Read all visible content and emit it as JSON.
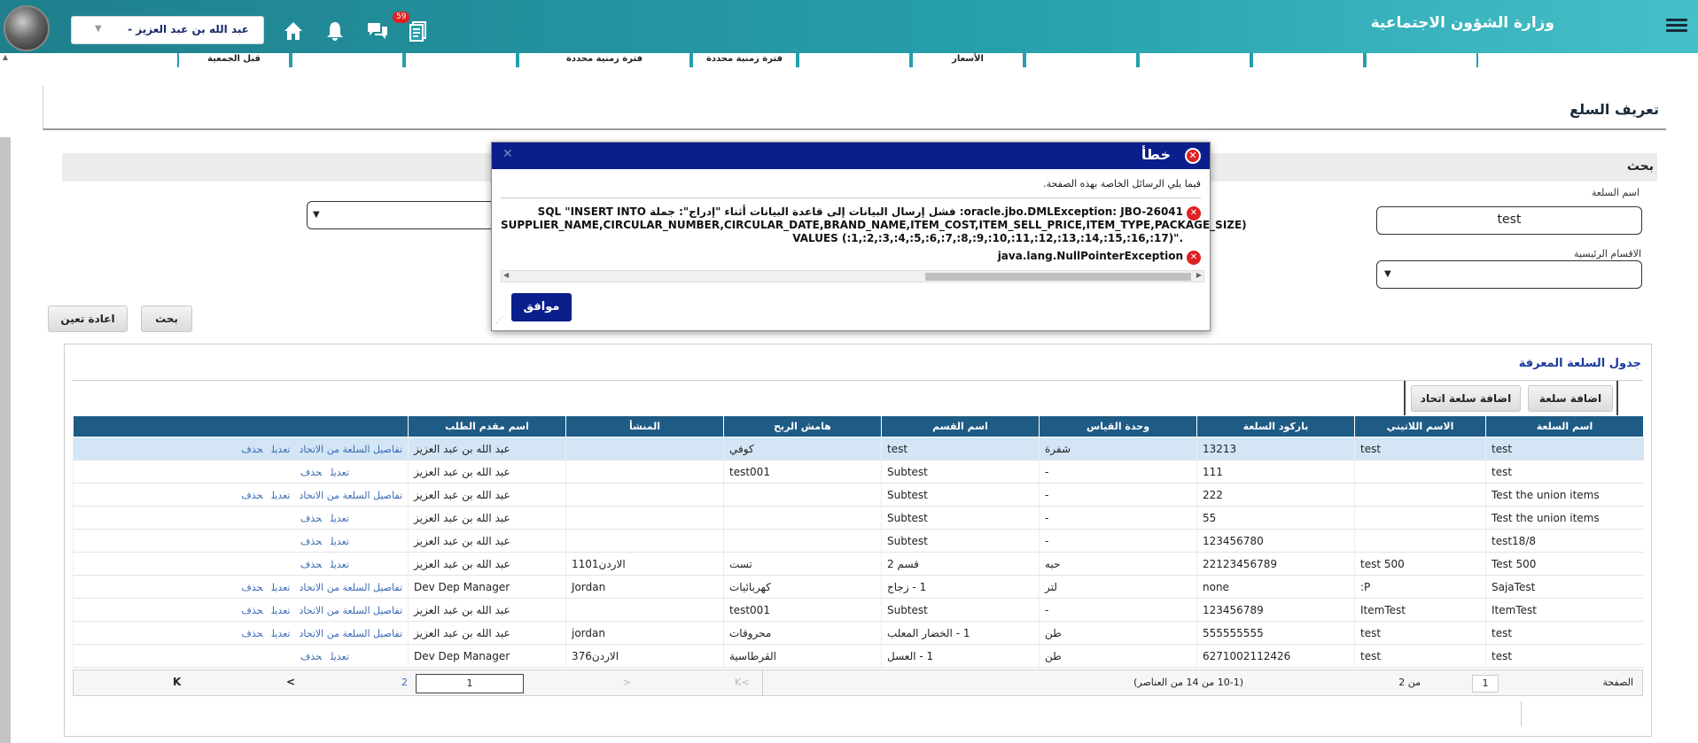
{
  "header": {
    "ministry_title": "وزارة الشؤون الاجتماعية",
    "user_name": "عبد الله بن عبد العزيز",
    "user_prefix": "-",
    "notification_count": "59"
  },
  "stubs": [
    "قبل الجمعية",
    "فترة زمنية محددة",
    "فترة زمنية محددة",
    "الأسعار"
  ],
  "page": {
    "title": "تعريف السلع"
  },
  "search": {
    "title": "بحث",
    "item_name_label": "اسم السلعة",
    "item_name_value": "test",
    "main_sections_label": "الاقسام الرئيسية",
    "search_button": "بحث",
    "reset_button": "اعادة تعين"
  },
  "table": {
    "title": "جدول السلعة المعرفة",
    "add_item_button": "اضافة سلعة",
    "add_union_item_button": "اضافة سلعة اتحاد",
    "columns": [
      "اسم السلعة",
      "الاسم اللاتيني",
      "باركود السلعة",
      "وحدة القياس",
      "اسم القسم",
      "هامش الربح",
      "المنشأ",
      "اسم مقدم الطلب",
      ""
    ],
    "link_details": "تفاصيل السلعة من الاتحاد",
    "link_edit": "تعديل",
    "link_delete": "حذف",
    "rows": [
      {
        "name": "test",
        "latin": "test",
        "barcode": "13213",
        "unit": "شفرة",
        "section": "test",
        "margin": "كوفي",
        "origin": "",
        "requester": "عبد الله بن عبد العزيز",
        "details": true
      },
      {
        "name": "test",
        "latin": "",
        "barcode": "111",
        "unit": "-",
        "section": "Subtest",
        "margin": "test001",
        "origin": "",
        "requester": "عبد الله بن عبد العزيز",
        "details": false
      },
      {
        "name": "Test the union items",
        "latin": "",
        "barcode": "222",
        "unit": "-",
        "section": "Subtest",
        "margin": "",
        "origin": "",
        "requester": "عبد الله بن عبد العزيز",
        "details": true
      },
      {
        "name": "Test the union items",
        "latin": "",
        "barcode": "55",
        "unit": "-",
        "section": "Subtest",
        "margin": "",
        "origin": "",
        "requester": "عبد الله بن عبد العزيز",
        "details": false
      },
      {
        "name": "test18/8",
        "latin": "",
        "barcode": "123456780",
        "unit": "-",
        "section": "Subtest",
        "margin": "",
        "origin": "",
        "requester": "عبد الله بن عبد العزيز",
        "details": false
      },
      {
        "name": "Test 500",
        "latin": "test 500",
        "barcode": "22123456789",
        "unit": "حبه",
        "section": "قسم 2",
        "margin": "تست",
        "origin": "الاردن1101",
        "requester": "عبد الله بن عبد العزيز",
        "details": false
      },
      {
        "name": "SajaTest",
        "latin": "P:",
        "barcode": "none",
        "unit": "لتر",
        "section": "1 - زجاج",
        "margin": "كهربائيات",
        "origin": "Jordan",
        "requester": "Dev Dep Manager",
        "details": true
      },
      {
        "name": "ItemTest",
        "latin": "ItemTest",
        "barcode": "123456789",
        "unit": "-",
        "section": "Subtest",
        "margin": "test001",
        "origin": "",
        "requester": "عبد الله بن عبد العزيز",
        "details": true
      },
      {
        "name": "test",
        "latin": "test",
        "barcode": "555555555",
        "unit": "طن",
        "section": "1 - الخضار المعلب",
        "margin": "محروقات",
        "origin": "jordan",
        "requester": "عبد الله بن عبد العزيز",
        "details": true
      },
      {
        "name": "test",
        "latin": "test",
        "barcode": "6271002112426",
        "unit": "طن",
        "section": "1 - العسل",
        "margin": "القرطاسية",
        "origin": "الاردن376",
        "requester": "Dev Dep Manager",
        "details": false
      }
    ]
  },
  "pager": {
    "page_label": "الصفحة",
    "current_page": "1",
    "of_pages": "من 2",
    "range_text": "(10-1 من 14 من العناصر)",
    "nav_page_input": "1",
    "nav_total": "2",
    "first": "K",
    "prev": "<"
  },
  "dialog": {
    "title": "خطأ",
    "intro": "فيما يلي الرسائل الخاصة بهذه الصفحة.",
    "error_1_line1": "oracle.jbo.DMLException: JBO-26041: فشل إرسال البيانات إلى قاعدة البيانات أثناء \"إدراج\": جملة SQL \"INSERT INTO",
    "error_1_line2": "SUPPLIER_NAME,CIRCULAR_NUMBER,CIRCULAR_DATE,BRAND_NAME,ITEM_COST,ITEM_SELL_PRICE,ITEM_TYPE,PACKAGE_SIZE)",
    "error_1_line3": "VALUES (:1,:2,:3,:4,:5,:6,:7,:8,:9,:10,:11,:12,:13,:14,:15,:16,:17)\".",
    "error_2": "java.lang.NullPointerException",
    "ok_button": "موافق"
  }
}
